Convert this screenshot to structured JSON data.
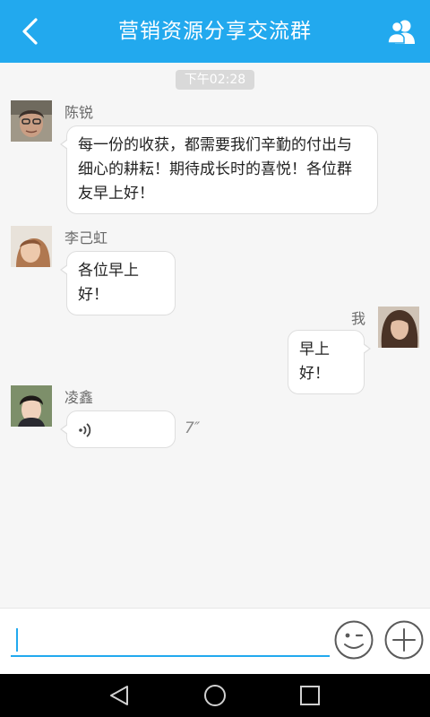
{
  "header": {
    "title": "营销资源分享交流群",
    "bg_color": "#22a9ee"
  },
  "chat": {
    "timestamp": "下午02:28",
    "messages": [
      {
        "sender": "陈锐",
        "text": "每一份的收获，都需要我们辛勤的付出与细心的耕耘！期待成长时的喜悦！各位群友早上好！",
        "side": "left"
      },
      {
        "sender": "李己虹",
        "text": "各位早上好！",
        "side": "left"
      },
      {
        "sender": "我",
        "text": "早上好！",
        "side": "right"
      },
      {
        "sender": "凌鑫",
        "type": "voice",
        "duration": "7″",
        "side": "left"
      }
    ]
  },
  "input": {
    "placeholder": "",
    "value": ""
  },
  "icons": {
    "back": "chevron-left-icon",
    "members": "group-members-icon",
    "emoji": "smiley-wink-icon",
    "plus": "plus-circle-icon",
    "voice": "voice-wave-icon",
    "nav_back": "triangle-back-icon",
    "nav_home": "circle-home-icon",
    "nav_recent": "square-recent-icon"
  }
}
